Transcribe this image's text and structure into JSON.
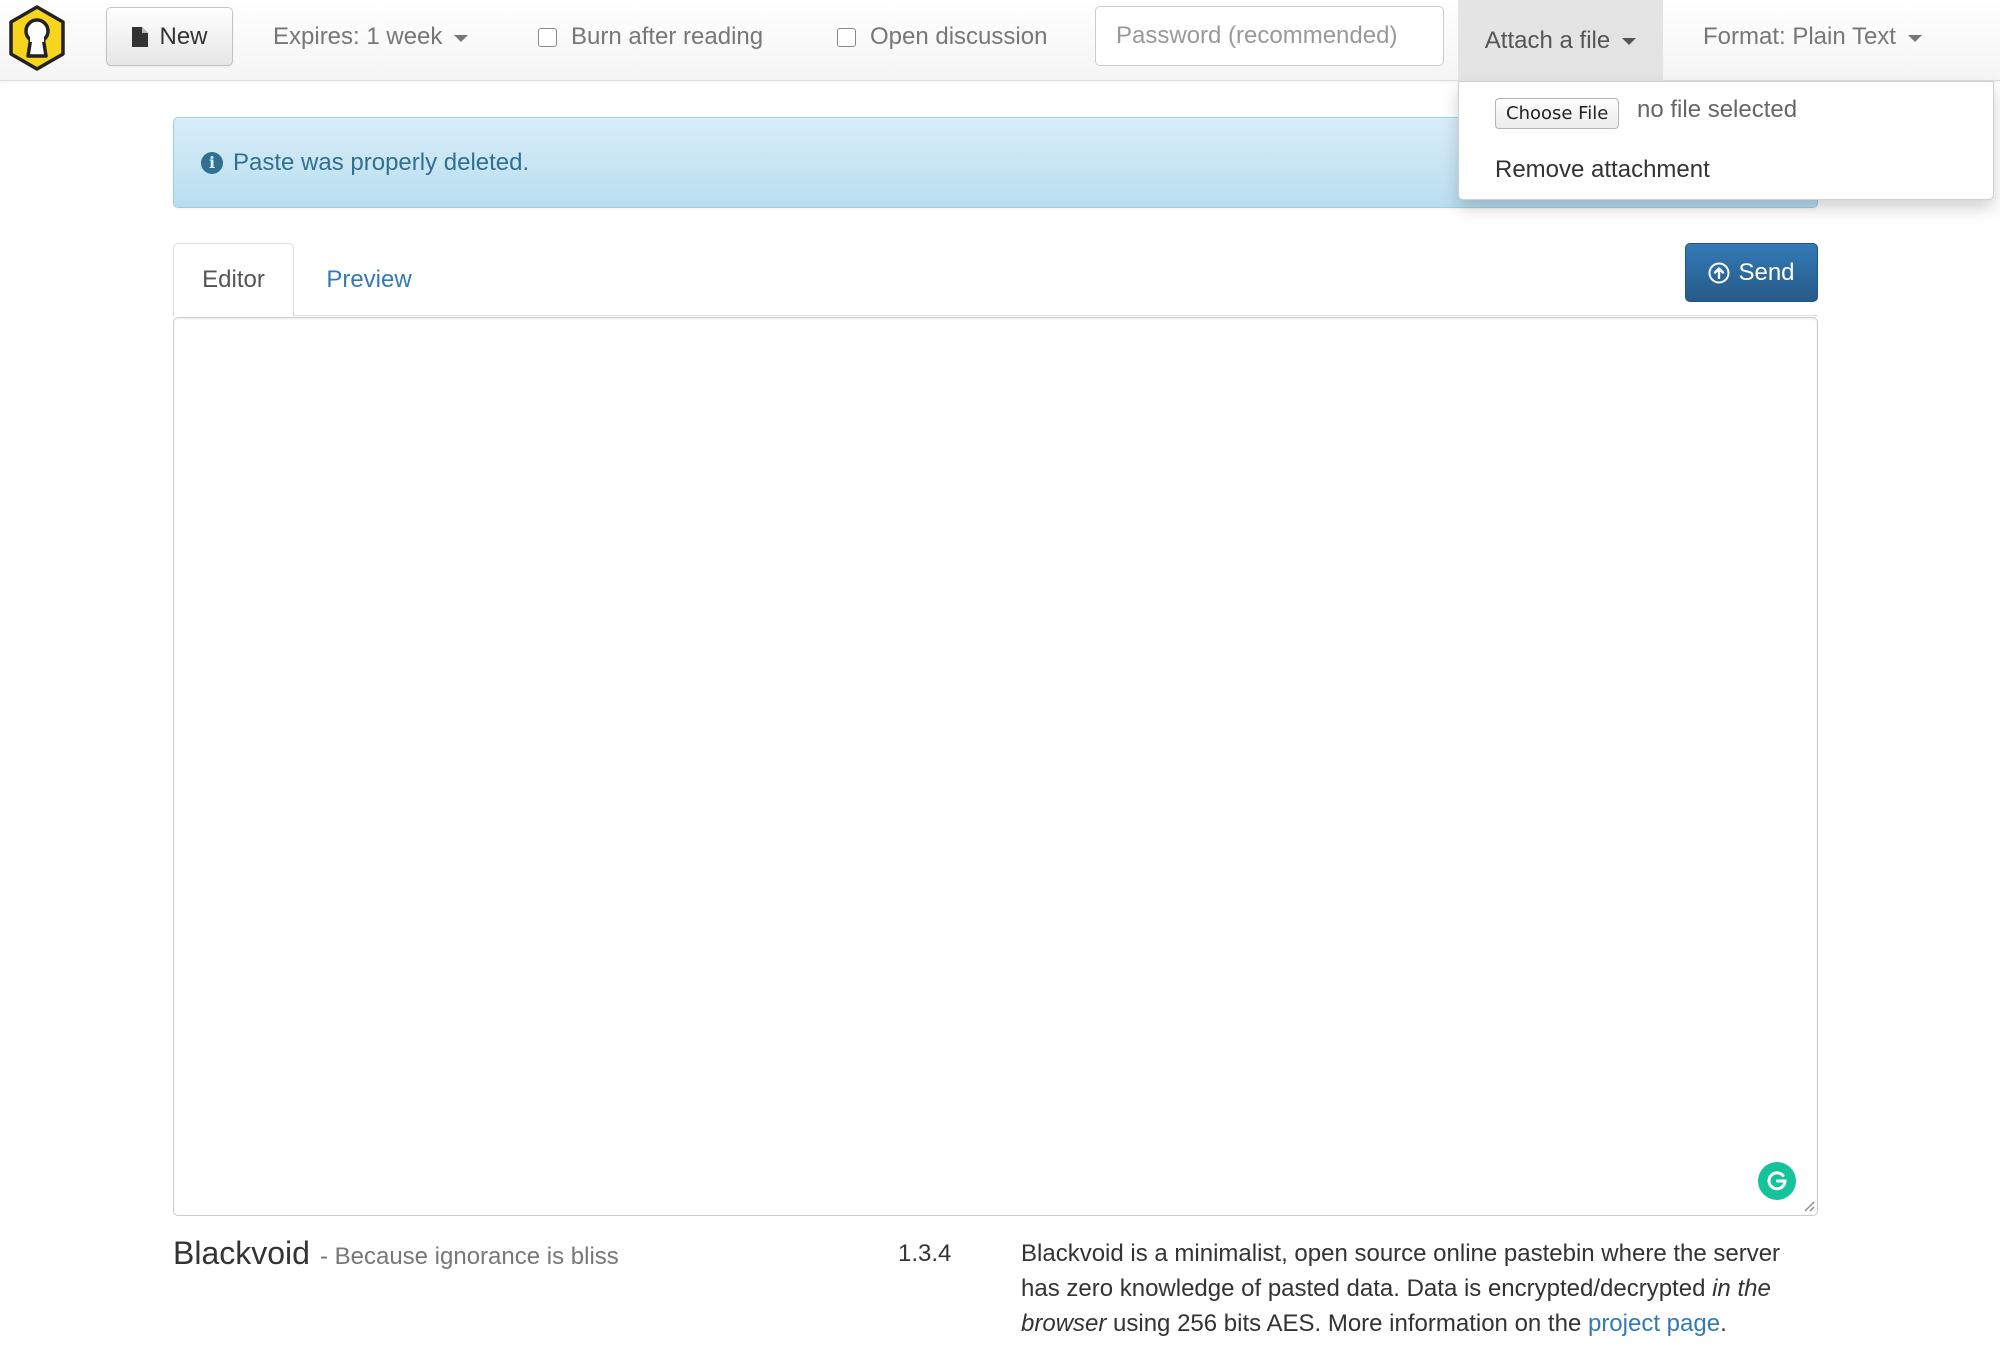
{
  "navbar": {
    "new_label": "New",
    "expires_label": "Expires: 1 week",
    "burn_label": "Burn after reading",
    "discussion_label": "Open discussion",
    "password_placeholder": "Password (recommended)",
    "attach_label": "Attach a file",
    "format_label": "Format: Plain Text"
  },
  "attach_menu": {
    "choose_file_label": "Choose File",
    "no_file_text": "no file selected",
    "remove_label": "Remove attachment"
  },
  "alert": {
    "message": "Paste was properly deleted."
  },
  "tabs": {
    "editor_label": "Editor",
    "preview_label": "Preview"
  },
  "send_label": "Send",
  "footer": {
    "brand": "Blackvoid",
    "slogan": "- Because ignorance is bliss",
    "version": "1.3.4",
    "about_part1": "Blackvoid is a minimalist, open source online pastebin where the server has zero knowledge of pasted data. Data is encrypted/decrypted ",
    "about_italic": "in the browser",
    "about_part2": " using 256 bits AES. More information on the ",
    "about_link": "project page",
    "about_end": "."
  },
  "colors": {
    "logo_yellow": "#f7d51d",
    "primary_blue": "#337ab7",
    "info_text": "#31708f",
    "grammarly_green": "#15c39a"
  }
}
